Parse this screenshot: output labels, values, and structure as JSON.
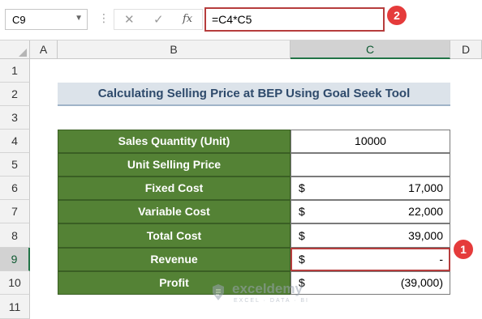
{
  "formula_bar": {
    "name_box": "C9",
    "cancel_icon": "✕",
    "enter_icon": "✓",
    "fx_icon": "fx",
    "formula": "=C4*C5"
  },
  "annotations": {
    "badge_1": "1",
    "badge_2": "2"
  },
  "columns": [
    "A",
    "B",
    "C",
    "D"
  ],
  "selected_column": "C",
  "rows": [
    "1",
    "2",
    "3",
    "4",
    "5",
    "6",
    "7",
    "8",
    "9",
    "10",
    "11"
  ],
  "selected_row": "9",
  "sheet": {
    "title": "Calculating Selling Price at BEP Using Goal Seek Tool",
    "table": [
      {
        "label": "Sales Quantity (Unit)",
        "currency": "",
        "value": "10000",
        "centered": true
      },
      {
        "label": "Unit Selling Price",
        "currency": "",
        "value": ""
      },
      {
        "label": "Fixed Cost",
        "currency": "$",
        "value": "17,000"
      },
      {
        "label": "Variable Cost",
        "currency": "$",
        "value": "22,000"
      },
      {
        "label": "Total Cost",
        "currency": "$",
        "value": "39,000"
      },
      {
        "label": "Revenue",
        "currency": "$",
        "value": "-"
      },
      {
        "label": "Profit",
        "currency": "$",
        "value": "(39,000)"
      }
    ]
  },
  "watermark": {
    "name": "exceldemy",
    "tagline": "EXCEL · DATA · BI"
  },
  "colors": {
    "label_fill": "#548235",
    "title_fill": "#dce3ea",
    "highlight": "#b63d3d",
    "badge": "#e53b3b"
  }
}
